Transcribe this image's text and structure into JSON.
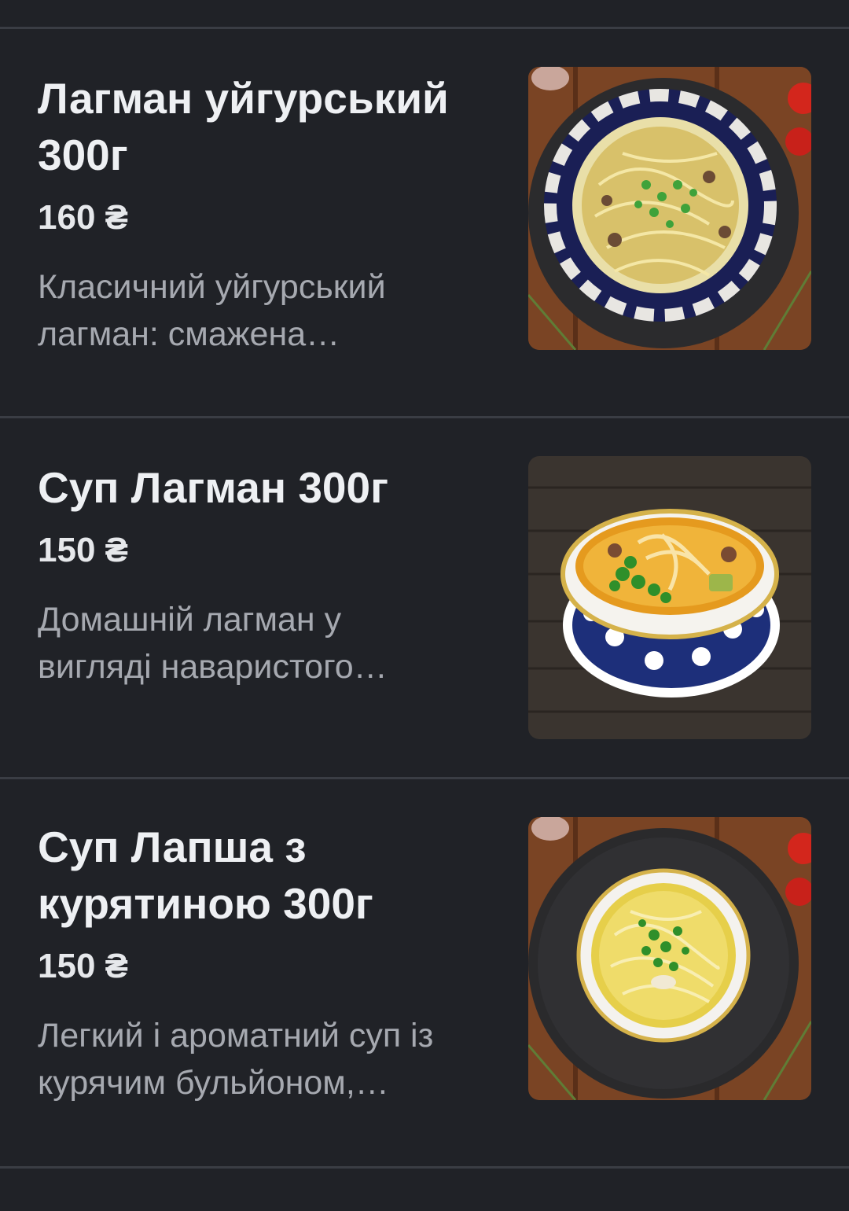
{
  "currency_symbol": "₴",
  "items": [
    {
      "title": "Лагман уйгурський 300г",
      "price": "160 ₴",
      "description": "Класичний уйгурський лагман: смажена…"
    },
    {
      "title": "Суп Лагман 300г",
      "price": "150 ₴",
      "description": "Домашній лагман у вигляді наваристого…"
    },
    {
      "title": "Суп Лапша з курятиною 300г",
      "price": "150 ₴",
      "description": "Легкий і ароматний суп із курячим бульйоном,…"
    }
  ],
  "colors": {
    "background": "#202227",
    "divider": "#3a3d44",
    "title": "#eef0f3",
    "description": "#a6a9b0"
  }
}
